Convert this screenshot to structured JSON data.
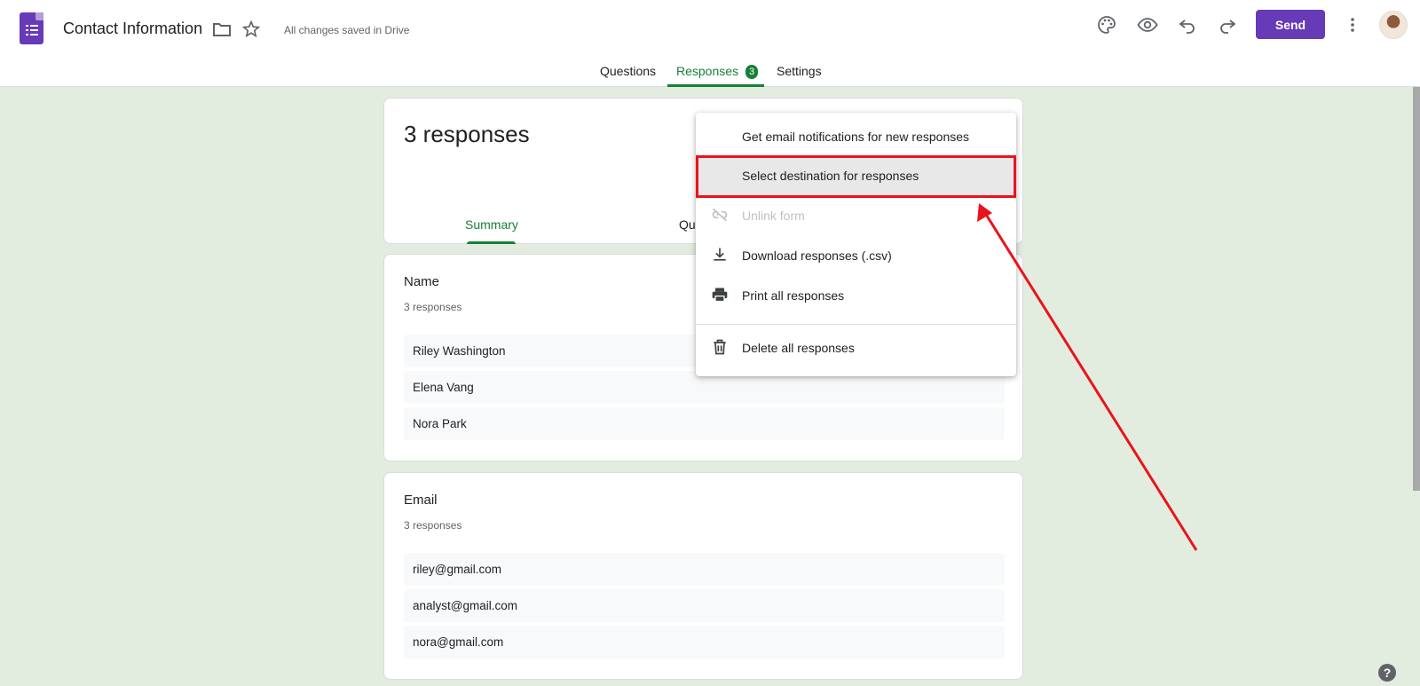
{
  "app": {
    "title": "Contact Information",
    "save_status": "All changes saved in Drive"
  },
  "toolbar": {
    "icons": [
      "palette-icon",
      "eye-icon",
      "undo-icon",
      "redo-icon",
      "more-vert-icon"
    ],
    "send_label": "Send"
  },
  "tabs": [
    {
      "label": "Questions",
      "active": false
    },
    {
      "label": "Responses",
      "active": true,
      "badge": "3"
    },
    {
      "label": "Settings",
      "active": false
    }
  ],
  "summary": {
    "title": "3 responses",
    "subtabs": [
      "Summary",
      "Qu"
    ]
  },
  "questions": [
    {
      "title": "Name",
      "count": "3 responses",
      "answers": [
        "Riley Washington",
        "Elena Vang",
        "Nora Park"
      ]
    },
    {
      "title": "Email",
      "count": "3 responses",
      "answers": [
        "riley@gmail.com",
        "analyst@gmail.com",
        "nora@gmail.com"
      ]
    }
  ],
  "menu": {
    "items": [
      {
        "label": "Get email notifications for new responses",
        "icon": "none",
        "disabled": false
      },
      {
        "label": "Select destination for responses",
        "icon": "none",
        "disabled": false,
        "selected": true
      },
      {
        "label": "Unlink form",
        "icon": "unlink-icon",
        "disabled": true
      },
      {
        "label": "Download responses (.csv)",
        "icon": "download-icon",
        "disabled": false
      },
      {
        "label": "Print all responses",
        "icon": "print-icon",
        "disabled": false
      },
      {
        "label": "Delete all responses",
        "icon": "trash-icon",
        "disabled": false
      }
    ]
  },
  "colors": {
    "brand": "#673ab7",
    "accent": "#188038",
    "background": "#e2ecdf",
    "annotation": "#e8141c"
  },
  "help_label": "?"
}
